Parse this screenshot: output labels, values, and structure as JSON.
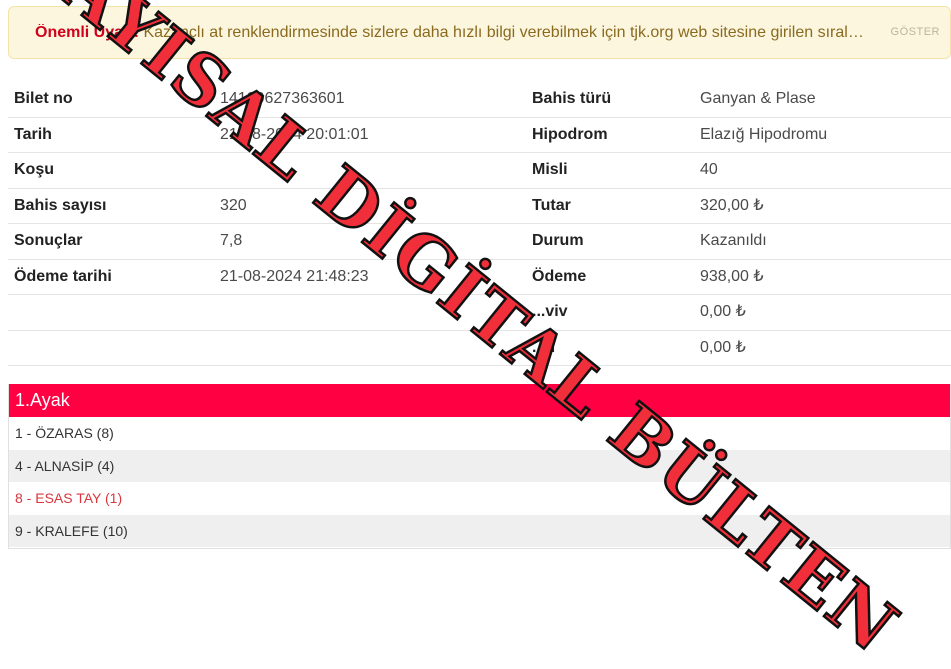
{
  "alert": {
    "title": "Önemli Uyarı!",
    "message": "Kazançlı at renklendirmesinde sizlere daha hızlı bilgi verebilmek için tjk.org web sitesine girilen sırala...",
    "button": "GÖSTER"
  },
  "ticket": {
    "rows": [
      {
        "l1": "Bilet no",
        "v1": "14100627363601",
        "l2": "Bahis türü",
        "v2": "Ganyan & Plase"
      },
      {
        "l1": "Tarih",
        "v1": "21-08-2024 20:01:01",
        "l2": "Hipodrom",
        "v2": "Elazığ Hipodromu"
      },
      {
        "l1": "Koşu",
        "v1": "",
        "l2": "Misli",
        "v2": "40"
      },
      {
        "l1": "Bahis sayısı",
        "v1": "320",
        "l2": "Tutar",
        "v2": "320,00 ₺"
      },
      {
        "l1": "Sonuçlar",
        "v1": "7,8",
        "l2": "Durum",
        "v2": "Kazanıldı"
      },
      {
        "l1": "Ödeme tarihi",
        "v1": "21-08-2024 21:48:23",
        "l2": "Ödeme",
        "v2": "938,00 ₺"
      },
      {
        "l1": "",
        "v1": "",
        "l2": "...viv",
        "v2": "0,00 ₺"
      },
      {
        "l1": "",
        "v1": "",
        "l2": "...d",
        "v2": "0,00 ₺"
      }
    ]
  },
  "leg": {
    "title": "1.Ayak",
    "horses": [
      "1 - ÖZARAS (8)",
      "4 - ALNASİP (4)",
      "8 - ESAS TAY (1)",
      "9 - KRALEFE (10)"
    ]
  },
  "watermark": "SAYISAL DİGİTAL BÜLTEN",
  "colors": {
    "accent": "#ff0043",
    "alert_bg": "#fcf6df",
    "alert_title": "#d0021b",
    "highlight_horse": "#d9363e",
    "watermark": "#f12f3a"
  }
}
